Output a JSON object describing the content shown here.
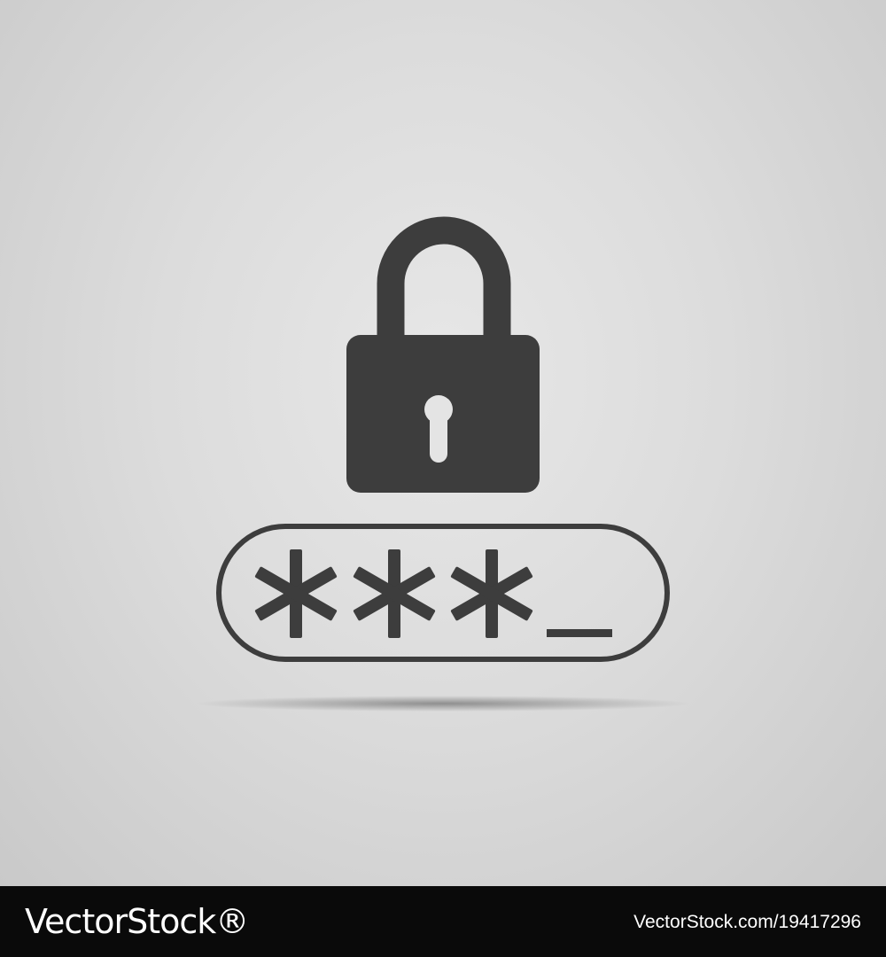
{
  "illustration": {
    "lock_icon": "padlock-icon",
    "keyhole_icon": "keyhole-icon",
    "password_field": {
      "masked_value": "***",
      "cursor": "_"
    },
    "colors": {
      "icon": "#3d3d3d",
      "background": "#dcdcdc",
      "keyhole": "#e4e4e4"
    }
  },
  "footer": {
    "brand": "VectorStock®",
    "image_id": "VectorStock.com/19417296",
    "background": "#0a0a0a"
  }
}
